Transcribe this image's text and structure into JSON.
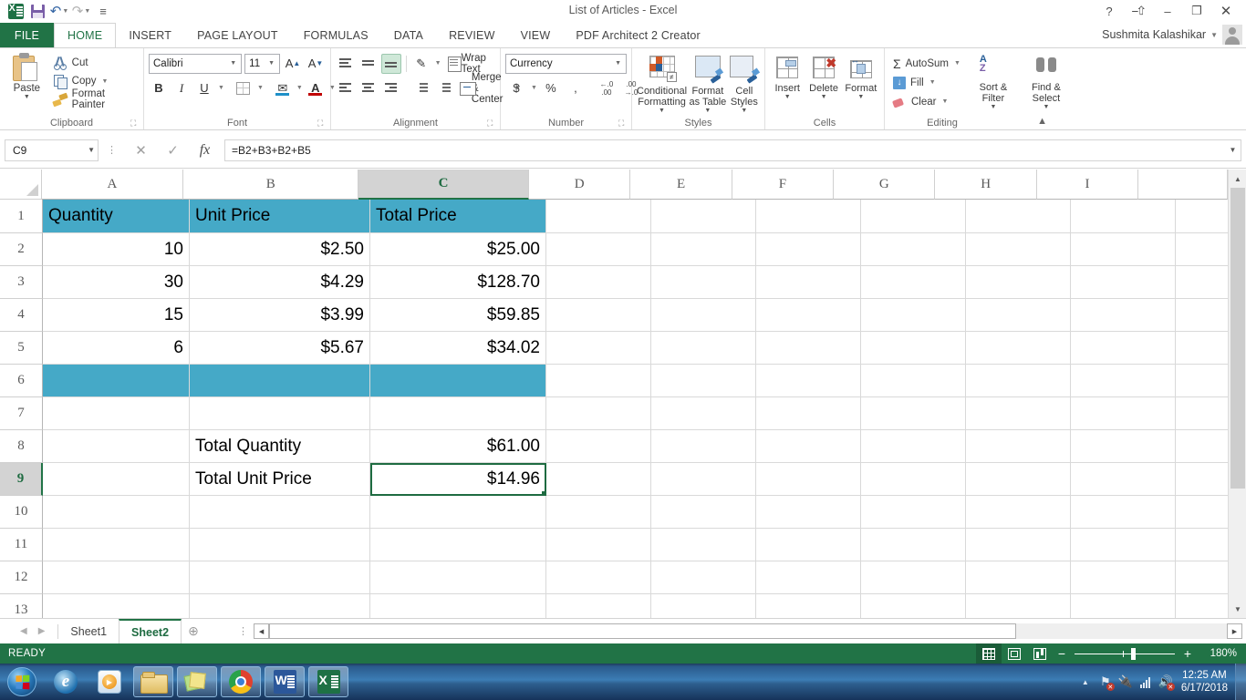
{
  "window": {
    "title": "List of Articles - Excel",
    "user": "Sushmita Kalashikar",
    "help": "?",
    "ribbon_display": "ribbon-display-icon",
    "minimize": "–",
    "restore": "❐",
    "close": "✕"
  },
  "qat": {
    "app_icon": "excel-icon",
    "save": "save-icon",
    "undo": "undo-icon",
    "redo": "redo-icon",
    "more": "customize-qat-icon"
  },
  "tabs": [
    {
      "label": "FILE",
      "active": false
    },
    {
      "label": "HOME",
      "active": true
    },
    {
      "label": "INSERT",
      "active": false
    },
    {
      "label": "PAGE LAYOUT",
      "active": false
    },
    {
      "label": "FORMULAS",
      "active": false
    },
    {
      "label": "DATA",
      "active": false
    },
    {
      "label": "REVIEW",
      "active": false
    },
    {
      "label": "VIEW",
      "active": false
    },
    {
      "label": "PDF Architect 2 Creator",
      "active": false
    }
  ],
  "ribbon": {
    "clipboard": {
      "label": "Clipboard",
      "paste": "Paste",
      "cut": "Cut",
      "copy": "Copy",
      "format_painter": "Format Painter"
    },
    "font": {
      "label": "Font",
      "font_name": "Calibri",
      "font_size": "11",
      "grow": "A",
      "shrink": "A",
      "bold": "B",
      "italic": "I",
      "underline": "U",
      "fill_color": "#1e90c8",
      "font_color": "#c00000"
    },
    "alignment": {
      "label": "Alignment",
      "wrap_text": "Wrap Text",
      "merge_center": "Merge & Center"
    },
    "number": {
      "label": "Number",
      "format": "Currency",
      "currency": "$",
      "percent": "%",
      "comma": ",",
      "increase_decimal": ".00",
      "decrease_decimal": ".00"
    },
    "styles": {
      "label": "Styles",
      "conditional_formatting": "Conditional Formatting",
      "format_as_table": "Format as Table",
      "cell_styles": "Cell Styles"
    },
    "cells": {
      "label": "Cells",
      "insert": "Insert",
      "delete": "Delete",
      "format": "Format"
    },
    "editing": {
      "label": "Editing",
      "autosum": "AutoSum",
      "fill": "Fill",
      "clear": "Clear",
      "sort_filter": "Sort & Filter",
      "find_select": "Find & Select"
    }
  },
  "formula_bar": {
    "name_box": "C9",
    "cancel": "✕",
    "enter": "✓",
    "insert_function": "fx",
    "formula": "=B2+B3+B2+B5"
  },
  "grid": {
    "columns": [
      "A",
      "B",
      "C",
      "D",
      "E",
      "F",
      "G",
      "H",
      "I"
    ],
    "selected_column": "C",
    "selected_row": 9,
    "rows": [
      {
        "num": "1",
        "cells": [
          "Quantity",
          "Unit Price",
          "Total Price",
          "",
          "",
          "",
          "",
          "",
          ""
        ],
        "style": "header"
      },
      {
        "num": "2",
        "cells": [
          "10",
          "$2.50",
          "$25.00",
          "",
          "",
          "",
          "",
          "",
          ""
        ],
        "style": "data"
      },
      {
        "num": "3",
        "cells": [
          "30",
          "$4.29",
          "$128.70",
          "",
          "",
          "",
          "",
          "",
          ""
        ],
        "style": "data"
      },
      {
        "num": "4",
        "cells": [
          "15",
          "$3.99",
          "$59.85",
          "",
          "",
          "",
          "",
          "",
          ""
        ],
        "style": "data"
      },
      {
        "num": "5",
        "cells": [
          "6",
          "$5.67",
          "$34.02",
          "",
          "",
          "",
          "",
          "",
          ""
        ],
        "style": "data"
      },
      {
        "num": "6",
        "cells": [
          "",
          "",
          "",
          "",
          "",
          "",
          "",
          "",
          ""
        ],
        "style": "fill"
      },
      {
        "num": "7",
        "cells": [
          "",
          "",
          "",
          "",
          "",
          "",
          "",
          "",
          ""
        ],
        "style": "data"
      },
      {
        "num": "8",
        "cells": [
          "",
          "Total Quantity",
          "$61.00",
          "",
          "",
          "",
          "",
          "",
          ""
        ],
        "style": "data"
      },
      {
        "num": "9",
        "cells": [
          "",
          "Total Unit Price",
          "$14.96",
          "",
          "",
          "",
          "",
          "",
          ""
        ],
        "style": "data"
      },
      {
        "num": "10",
        "cells": [
          "",
          "",
          "",
          "",
          "",
          "",
          "",
          "",
          ""
        ],
        "style": "data"
      },
      {
        "num": "11",
        "cells": [
          "",
          "",
          "",
          "",
          "",
          "",
          "",
          "",
          ""
        ],
        "style": "data"
      },
      {
        "num": "12",
        "cells": [
          "",
          "",
          "",
          "",
          "",
          "",
          "",
          "",
          ""
        ],
        "style": "data"
      },
      {
        "num": "13",
        "cells": [
          "",
          "",
          "",
          "",
          "",
          "",
          "",
          "",
          ""
        ],
        "style": "data"
      }
    ],
    "header_fill": "#45a9c7",
    "selection_color": "#1e6b41"
  },
  "sheet_tabs": {
    "first": "◀",
    "prev": "▶",
    "sheets": [
      {
        "name": "Sheet1",
        "active": false
      },
      {
        "name": "Sheet2",
        "active": true
      }
    ],
    "add": "⊕"
  },
  "status_bar": {
    "text": "READY",
    "view_normal": "normal-view-icon",
    "view_page_layout": "page-layout-view-icon",
    "view_page_break": "page-break-view-icon",
    "zoom_out": "−",
    "zoom_in": "+",
    "zoom_level": "180%"
  },
  "taskbar": {
    "start": "start-orb-icon",
    "items": [
      {
        "name": "internet-explorer",
        "pinned": true
      },
      {
        "name": "windows-media-player",
        "pinned": true
      },
      {
        "name": "file-explorer",
        "running": true
      },
      {
        "name": "sticky-notes",
        "running": true
      },
      {
        "name": "google-chrome",
        "running": true
      },
      {
        "name": "microsoft-word",
        "running": true
      },
      {
        "name": "microsoft-excel",
        "running": true
      }
    ],
    "tray": {
      "show_hidden": "▲",
      "action_center": "flag-icon",
      "network_plug": "network-icon",
      "signal": "signal-icon",
      "volume": "volume-muted-icon"
    },
    "clock_time": "12:25 AM",
    "clock_date": "6/17/2018"
  }
}
